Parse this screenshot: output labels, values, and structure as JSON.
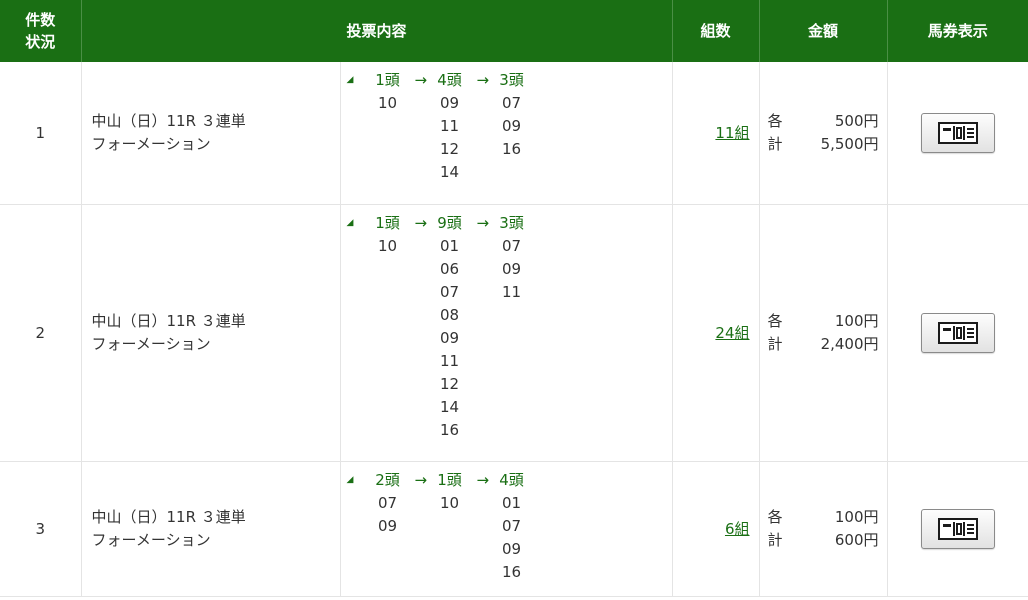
{
  "header": {
    "status": [
      "件数",
      "状況"
    ],
    "content": "投票内容",
    "count": "組数",
    "amount": "金額",
    "ticket": "馬券表示"
  },
  "rows": [
    {
      "num": "1",
      "race": "中山（日）11R ３連単",
      "method": "フォーメーション",
      "cols": [
        {
          "label": "1頭",
          "horses": [
            "10"
          ]
        },
        {
          "label": "4頭",
          "horses": [
            "09",
            "11",
            "12",
            "14"
          ]
        },
        {
          "label": "3頭",
          "horses": [
            "07",
            "09",
            "16"
          ]
        }
      ],
      "count": "11組",
      "each_label": "各",
      "each": "500円",
      "total_label": "計",
      "total": "5,500円"
    },
    {
      "num": "2",
      "race": "中山（日）11R ３連単",
      "method": "フォーメーション",
      "cols": [
        {
          "label": "1頭",
          "horses": [
            "10"
          ]
        },
        {
          "label": "9頭",
          "horses": [
            "01",
            "06",
            "07",
            "08",
            "09",
            "11",
            "12",
            "14",
            "16"
          ]
        },
        {
          "label": "3頭",
          "horses": [
            "07",
            "09",
            "11"
          ]
        }
      ],
      "count": "24組",
      "each_label": "各",
      "each": "100円",
      "total_label": "計",
      "total": "2,400円"
    },
    {
      "num": "3",
      "race": "中山（日）11R ３連単",
      "method": "フォーメーション",
      "cols": [
        {
          "label": "2頭",
          "horses": [
            "07",
            "09"
          ]
        },
        {
          "label": "1頭",
          "horses": [
            "10"
          ]
        },
        {
          "label": "4頭",
          "horses": [
            "01",
            "07",
            "09",
            "16"
          ]
        }
      ],
      "count": "6組",
      "each_label": "各",
      "each": "100円",
      "total_label": "計",
      "total": "600円"
    }
  ],
  "arrow": "→",
  "icons": {
    "toggle": "triangle-icon",
    "ticket": "ticket-icon"
  },
  "colors": {
    "header_bg": "#1a6f14",
    "accent": "#1a6f14"
  }
}
